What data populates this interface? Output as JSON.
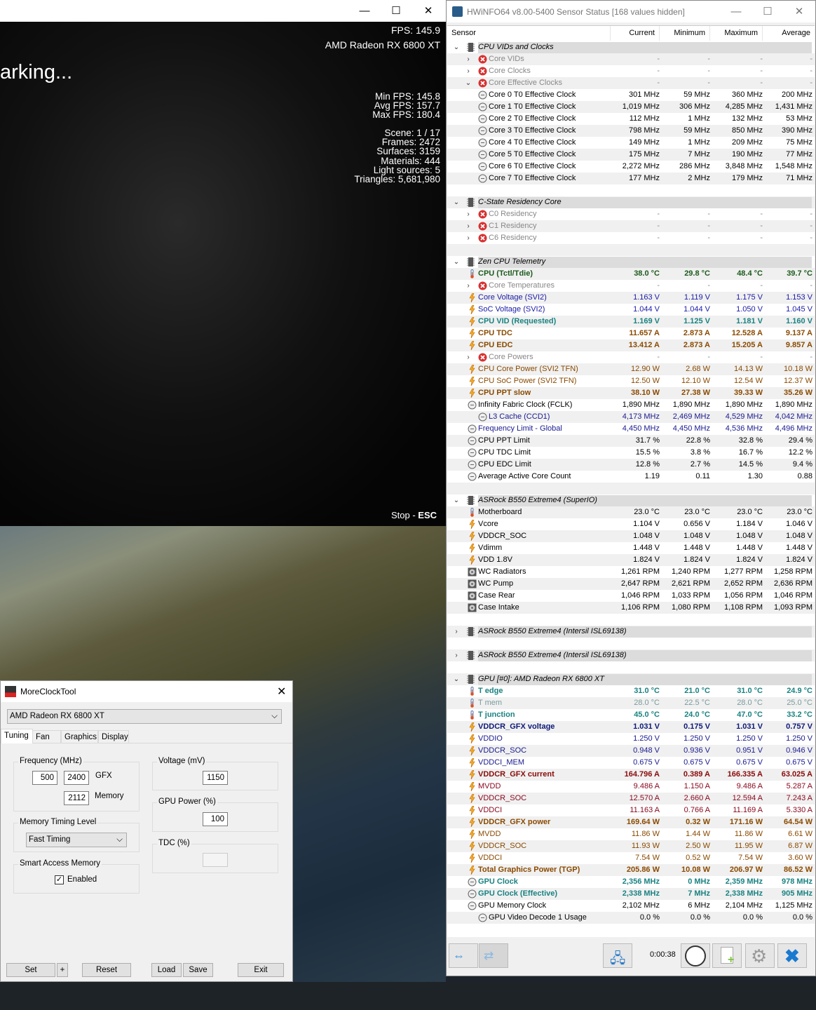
{
  "game": {
    "fps": "FPS: 145.9",
    "gpu": "AMD Radeon RX 6800 XT",
    "status": "arking...",
    "stats1": [
      "Min FPS: 145.8",
      "Avg FPS: 157.7",
      "Max FPS: 180.4"
    ],
    "stats2": [
      "Scene: 1 / 17",
      "Frames: 2472",
      "Surfaces: 3159",
      "Materials: 444",
      "Light sources: 5",
      "Triangles: 5,681,980"
    ],
    "stop_label": "Stop - ",
    "stop_key": "ESC"
  },
  "mct": {
    "title": "MoreClockTool",
    "device": "AMD Radeon RX 6800 XT",
    "tabs": [
      "Tuning",
      "Fan",
      "Graphics",
      "Display"
    ],
    "freq_label": "Frequency (MHz)",
    "gfx_min": "500",
    "gfx_max": "2400",
    "gfx_label": "GFX",
    "mem": "2112",
    "mem_label": "Memory",
    "timing_label": "Memory Timing Level",
    "timing_value": "Fast Timing",
    "sam_label": "Smart Access Memory",
    "sam_checkbox": "Enabled",
    "sam_checked": true,
    "volt_label": "Voltage (mV)",
    "volt": "1150",
    "power_label": "GPU Power (%)",
    "power": "100",
    "tdc_label": "TDC (%)",
    "tdc": "",
    "buttons": {
      "set": "Set",
      "plus": "+",
      "reset": "Reset",
      "load": "Load",
      "save": "Save",
      "exit": "Exit"
    }
  },
  "hwinfo": {
    "title": "HWiNFO64 v8.00-5400 Sensor Status [168 values hidden]",
    "columns": [
      "Sensor",
      "Current",
      "Minimum",
      "Maximum",
      "Average"
    ],
    "timer": "0:00:38",
    "colors": {
      "group_band": "#dcdcdc",
      "alt_row": "#f0f0f0",
      "voltage": "#1a1aa8",
      "temperature": "#1c5a1c",
      "power": "#8a4a00"
    },
    "rows": [
      {
        "t": "g",
        "label": "CPU VIDs and Clocks",
        "exp": "v"
      },
      {
        "label": "Core VIDs",
        "icon": "x",
        "s": "dis",
        "exp": ">",
        "c": "-",
        "mn": "-",
        "mx": "-",
        "a": "-"
      },
      {
        "label": "Core Clocks",
        "icon": "x",
        "s": "dis",
        "exp": ">",
        "c": "-",
        "mn": "-",
        "mx": "-",
        "a": "-"
      },
      {
        "label": "Core Effective Clocks",
        "icon": "x",
        "s": "dis",
        "exp": "v",
        "c": "-",
        "mn": "-",
        "mx": "-",
        "a": "-"
      },
      {
        "label": "Core 0 T0 Effective Clock",
        "icon": "clock",
        "s": "blk",
        "ind": 1,
        "c": "301 MHz",
        "mn": "59 MHz",
        "mx": "360 MHz",
        "a": "200 MHz"
      },
      {
        "label": "Core 1 T0 Effective Clock",
        "icon": "clock",
        "s": "blk",
        "ind": 1,
        "c": "1,019 MHz",
        "mn": "306 MHz",
        "mx": "4,285 MHz",
        "a": "1,431 MHz"
      },
      {
        "label": "Core 2 T0 Effective Clock",
        "icon": "clock",
        "s": "blk",
        "ind": 1,
        "c": "112 MHz",
        "mn": "1 MHz",
        "mx": "132 MHz",
        "a": "53 MHz"
      },
      {
        "label": "Core 3 T0 Effective Clock",
        "icon": "clock",
        "s": "blk",
        "ind": 1,
        "c": "798 MHz",
        "mn": "59 MHz",
        "mx": "850 MHz",
        "a": "390 MHz"
      },
      {
        "label": "Core 4 T0 Effective Clock",
        "icon": "clock",
        "s": "blk",
        "ind": 1,
        "c": "149 MHz",
        "mn": "1 MHz",
        "mx": "209 MHz",
        "a": "75 MHz"
      },
      {
        "label": "Core 5 T0 Effective Clock",
        "icon": "clock",
        "s": "blk",
        "ind": 1,
        "c": "175 MHz",
        "mn": "7 MHz",
        "mx": "190 MHz",
        "a": "77 MHz"
      },
      {
        "label": "Core 6 T0 Effective Clock",
        "icon": "clock",
        "s": "blk",
        "ind": 1,
        "c": "2,272 MHz",
        "mn": "286 MHz",
        "mx": "3,848 MHz",
        "a": "1,548 MHz"
      },
      {
        "label": "Core 7 T0 Effective Clock",
        "icon": "clock",
        "s": "blk",
        "ind": 1,
        "c": "177 MHz",
        "mn": "2 MHz",
        "mx": "179 MHz",
        "a": "71 MHz"
      },
      {
        "t": "b"
      },
      {
        "t": "g",
        "label": "C-State Residency Core",
        "exp": "v"
      },
      {
        "label": "C0 Residency",
        "icon": "x",
        "s": "dis",
        "exp": ">",
        "c": "-",
        "mn": "-",
        "mx": "-",
        "a": "-"
      },
      {
        "label": "C1 Residency",
        "icon": "x",
        "s": "dis",
        "exp": ">",
        "c": "-",
        "mn": "-",
        "mx": "-",
        "a": "-"
      },
      {
        "label": "C6 Residency",
        "icon": "x",
        "s": "dis",
        "exp": ">",
        "c": "-",
        "mn": "-",
        "mx": "-",
        "a": "-"
      },
      {
        "t": "b"
      },
      {
        "t": "g",
        "label": "Zen CPU Telemetry",
        "exp": "v"
      },
      {
        "label": "CPU (Tctl/Tdie)",
        "icon": "therm",
        "s": "tempg",
        "c": "38.0 °C",
        "mn": "29.8 °C",
        "mx": "48.4 °C",
        "a": "39.7 °C"
      },
      {
        "label": "Core Temperatures",
        "icon": "x",
        "s": "dis",
        "exp": ">",
        "c": "-",
        "mn": "-",
        "mx": "-",
        "a": "-"
      },
      {
        "label": "Core Voltage (SVI2)",
        "icon": "bolt",
        "s": "blue",
        "c": "1.163 V",
        "mn": "1.119 V",
        "mx": "1.175 V",
        "a": "1.153 V"
      },
      {
        "label": "SoC Voltage (SVI2)",
        "icon": "bolt",
        "s": "blue",
        "c": "1.044 V",
        "mn": "1.044 V",
        "mx": "1.050 V",
        "a": "1.045 V"
      },
      {
        "label": "CPU VID (Requested)",
        "icon": "bolt",
        "s": "teal",
        "c": "1.169 V",
        "mn": "1.125 V",
        "mx": "1.181 V",
        "a": "1.160 V"
      },
      {
        "label": "CPU TDC",
        "icon": "bolt",
        "s": "brownb",
        "c": "11.657 A",
        "mn": "2.873 A",
        "mx": "12.528 A",
        "a": "9.137 A"
      },
      {
        "label": "CPU EDC",
        "icon": "bolt",
        "s": "brownb",
        "c": "13.412 A",
        "mn": "2.873 A",
        "mx": "15.205 A",
        "a": "9.857 A"
      },
      {
        "label": "Core Powers",
        "icon": "x",
        "s": "dis",
        "exp": ">",
        "c": "-",
        "mn": "-",
        "mx": "-",
        "a": "-"
      },
      {
        "label": "CPU Core Power (SVI2 TFN)",
        "icon": "bolt",
        "s": "brown",
        "c": "12.90 W",
        "mn": "2.68 W",
        "mx": "14.13 W",
        "a": "10.18 W"
      },
      {
        "label": "CPU SoC Power (SVI2 TFN)",
        "icon": "bolt",
        "s": "brown",
        "c": "12.50 W",
        "mn": "12.10 W",
        "mx": "12.54 W",
        "a": "12.37 W"
      },
      {
        "label": "CPU PPT slow",
        "icon": "bolt",
        "s": "brownb",
        "c": "38.10 W",
        "mn": "27.38 W",
        "mx": "39.33 W",
        "a": "35.26 W"
      },
      {
        "label": "Infinity Fabric Clock (FCLK)",
        "icon": "clock",
        "s": "blk",
        "c": "1,890 MHz",
        "mn": "1,890 MHz",
        "mx": "1,890 MHz",
        "a": "1,890 MHz"
      },
      {
        "label": "L3 Cache (CCD1)",
        "icon": "clock",
        "s": "navy",
        "ind": 1,
        "c": "4,173 MHz",
        "mn": "2,469 MHz",
        "mx": "4,529 MHz",
        "a": "4,042 MHz"
      },
      {
        "label": "Frequency Limit - Global",
        "icon": "clock",
        "s": "navy",
        "c": "4,450 MHz",
        "mn": "4,450 MHz",
        "mx": "4,536 MHz",
        "a": "4,496 MHz"
      },
      {
        "label": "CPU PPT Limit",
        "icon": "clock",
        "s": "blk",
        "c": "31.7 %",
        "mn": "22.8 %",
        "mx": "32.8 %",
        "a": "29.4 %"
      },
      {
        "label": "CPU TDC Limit",
        "icon": "clock",
        "s": "blk",
        "c": "15.5 %",
        "mn": "3.8 %",
        "mx": "16.7 %",
        "a": "12.2 %"
      },
      {
        "label": "CPU EDC Limit",
        "icon": "clock",
        "s": "blk",
        "c": "12.8 %",
        "mn": "2.7 %",
        "mx": "14.5 %",
        "a": "9.4 %"
      },
      {
        "label": "Average Active Core Count",
        "icon": "clock",
        "s": "blk",
        "c": "1.19",
        "mn": "0.11",
        "mx": "1.30",
        "a": "0.88"
      },
      {
        "t": "b"
      },
      {
        "t": "g",
        "label": "ASRock B550 Extreme4 (SuperIO)",
        "exp": "v"
      },
      {
        "label": "Motherboard",
        "icon": "therm",
        "s": "blk",
        "c": "23.0 °C",
        "mn": "23.0 °C",
        "mx": "23.0 °C",
        "a": "23.0 °C"
      },
      {
        "label": "Vcore",
        "icon": "bolt",
        "s": "blk",
        "c": "1.104 V",
        "mn": "0.656 V",
        "mx": "1.184 V",
        "a": "1.046 V"
      },
      {
        "label": "VDDCR_SOC",
        "icon": "bolt",
        "s": "blk",
        "c": "1.048 V",
        "mn": "1.048 V",
        "mx": "1.048 V",
        "a": "1.048 V"
      },
      {
        "label": "Vdimm",
        "icon": "bolt",
        "s": "blk",
        "c": "1.448 V",
        "mn": "1.448 V",
        "mx": "1.448 V",
        "a": "1.448 V"
      },
      {
        "label": "VDD 1.8V",
        "icon": "bolt",
        "s": "blk",
        "c": "1.824 V",
        "mn": "1.824 V",
        "mx": "1.824 V",
        "a": "1.824 V"
      },
      {
        "label": "WC Radiators",
        "icon": "fan",
        "s": "blk",
        "c": "1,261 RPM",
        "mn": "1,240 RPM",
        "mx": "1,277 RPM",
        "a": "1,258 RPM"
      },
      {
        "label": "WC Pump",
        "icon": "fan",
        "s": "blk",
        "c": "2,647 RPM",
        "mn": "2,621 RPM",
        "mx": "2,652 RPM",
        "a": "2,636 RPM"
      },
      {
        "label": "Case Rear",
        "icon": "fan",
        "s": "blk",
        "c": "1,046 RPM",
        "mn": "1,033 RPM",
        "mx": "1,056 RPM",
        "a": "1,046 RPM"
      },
      {
        "label": "Case Intake",
        "icon": "fan",
        "s": "blk",
        "c": "1,106 RPM",
        "mn": "1,080 RPM",
        "mx": "1,108 RPM",
        "a": "1,093 RPM"
      },
      {
        "t": "b"
      },
      {
        "t": "g",
        "label": "ASRock B550 Extreme4 (Intersil ISL69138)",
        "exp": ">"
      },
      {
        "t": "b"
      },
      {
        "t": "g",
        "label": "ASRock B550 Extreme4 (Intersil ISL69138)",
        "exp": ">"
      },
      {
        "t": "b"
      },
      {
        "t": "g",
        "label": "GPU [#0]: AMD Radeon RX 6800 XT",
        "exp": "v"
      },
      {
        "label": "T edge",
        "icon": "therm",
        "s": "teal",
        "c": "31.0 °C",
        "mn": "21.0 °C",
        "mx": "31.0 °C",
        "a": "24.9 °C"
      },
      {
        "label": "T mem",
        "icon": "therm",
        "s": "tealdim",
        "c": "28.0 °C",
        "mn": "22.5 °C",
        "mx": "28.0 °C",
        "a": "25.0 °C"
      },
      {
        "label": "T junction",
        "icon": "therm",
        "s": "teal",
        "c": "45.0 °C",
        "mn": "24.0 °C",
        "mx": "47.0 °C",
        "a": "33.2 °C"
      },
      {
        "label": "VDDCR_GFX voltage",
        "icon": "bolt",
        "s": "navyb",
        "c": "1.031 V",
        "mn": "0.175 V",
        "mx": "1.031 V",
        "a": "0.757 V"
      },
      {
        "label": "VDDIO",
        "icon": "bolt",
        "s": "navy",
        "c": "1.250 V",
        "mn": "1.250 V",
        "mx": "1.250 V",
        "a": "1.250 V"
      },
      {
        "label": "VDDCR_SOC",
        "icon": "bolt",
        "s": "navy",
        "c": "0.948 V",
        "mn": "0.936 V",
        "mx": "0.951 V",
        "a": "0.946 V"
      },
      {
        "label": "VDDCI_MEM",
        "icon": "bolt",
        "s": "navy",
        "c": "0.675 V",
        "mn": "0.675 V",
        "mx": "0.675 V",
        "a": "0.675 V"
      },
      {
        "label": "VDDCR_GFX current",
        "icon": "bolt",
        "s": "redb",
        "c": "164.796 A",
        "mn": "0.389 A",
        "mx": "166.335 A",
        "a": "63.025 A"
      },
      {
        "label": "MVDD",
        "icon": "bolt",
        "s": "red",
        "c": "9.486 A",
        "mn": "1.150 A",
        "mx": "9.486 A",
        "a": "5.287 A"
      },
      {
        "label": "VDDCR_SOC",
        "icon": "bolt",
        "s": "red",
        "c": "12.570 A",
        "mn": "2.660 A",
        "mx": "12.594 A",
        "a": "7.243 A"
      },
      {
        "label": "VDDCI",
        "icon": "bolt",
        "s": "red",
        "c": "11.163 A",
        "mn": "0.766 A",
        "mx": "11.169 A",
        "a": "5.330 A"
      },
      {
        "label": "VDDCR_GFX power",
        "icon": "bolt",
        "s": "brownb",
        "c": "169.64 W",
        "mn": "0.32 W",
        "mx": "171.16 W",
        "a": "64.54 W"
      },
      {
        "label": "MVDD",
        "icon": "bolt",
        "s": "brown",
        "c": "11.86 W",
        "mn": "1.44 W",
        "mx": "11.86 W",
        "a": "6.61 W"
      },
      {
        "label": "VDDCR_SOC",
        "icon": "bolt",
        "s": "brown",
        "c": "11.93 W",
        "mn": "2.50 W",
        "mx": "11.95 W",
        "a": "6.87 W"
      },
      {
        "label": "VDDCI",
        "icon": "bolt",
        "s": "brown",
        "c": "7.54 W",
        "mn": "0.52 W",
        "mx": "7.54 W",
        "a": "3.60 W"
      },
      {
        "label": "Total Graphics Power (TGP)",
        "icon": "bolt",
        "s": "brownb",
        "c": "205.86 W",
        "mn": "10.08 W",
        "mx": "206.97 W",
        "a": "86.52 W"
      },
      {
        "label": "GPU Clock",
        "icon": "clock",
        "s": "teal",
        "c": "2,356 MHz",
        "mn": "0 MHz",
        "mx": "2,359 MHz",
        "a": "978 MHz"
      },
      {
        "label": "GPU Clock (Effective)",
        "icon": "clock",
        "s": "teal",
        "c": "2,338 MHz",
        "mn": "7 MHz",
        "mx": "2,338 MHz",
        "a": "905 MHz"
      },
      {
        "label": "GPU Memory Clock",
        "icon": "clock",
        "s": "blk",
        "c": "2,102 MHz",
        "mn": "6 MHz",
        "mx": "2,104 MHz",
        "a": "1,125 MHz"
      },
      {
        "label": "GPU Video Decode 1 Usage",
        "icon": "clock",
        "s": "blk",
        "ind": 1,
        "c": "0.0 %",
        "mn": "0.0 %",
        "mx": "0.0 %",
        "a": "0.0 %"
      }
    ]
  }
}
